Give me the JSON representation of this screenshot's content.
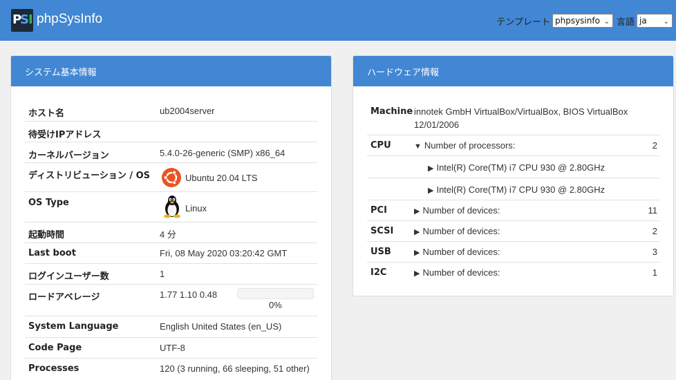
{
  "header": {
    "brand": "phpSysInfo",
    "template_label": "テンプレート",
    "template_value": "phpsysinfo",
    "language_label": "言語",
    "language_value": "ja"
  },
  "system": {
    "title": "システム基本情報",
    "rows": [
      {
        "label": "ホスト名",
        "value": "ub2004server"
      },
      {
        "label": "待受けIPアドレス",
        "value": ""
      },
      {
        "label": "カーネルバージョン",
        "value": "5.4.0-26-generic (SMP) x86_64"
      },
      {
        "label": "ディストリビューション / OS",
        "value": "Ubuntu 20.04 LTS",
        "icon": "ubuntu-logo-icon"
      },
      {
        "label": "OS Type",
        "value": "Linux",
        "icon": "linux-tux-icon"
      },
      {
        "label": "起動時間",
        "value": "4 分"
      },
      {
        "label": "Last boot",
        "value": "Fri, 08 May 2020 03:20:42 GMT"
      },
      {
        "label": "ログインユーザー数",
        "value": "1"
      },
      {
        "label": "ロードアベレージ",
        "value": "1.77 1.10 0.48",
        "progress": 0,
        "progress_text": "0%"
      },
      {
        "label": "System Language",
        "value": "English United States (en_US)"
      },
      {
        "label": "Code Page",
        "value": "UTF-8"
      },
      {
        "label": "Processes",
        "value": "120 (3 running, 66 sleeping, 51 other)"
      }
    ]
  },
  "hardware": {
    "title": "ハードウェア情報",
    "machine_label": "Machine",
    "machine_value_line1": "innotek GmbH VirtualBox/VirtualBox, BIOS VirtualBox",
    "machine_value_line2": "12/01/2006",
    "cpu": {
      "label": "CPU",
      "text": "Number of processors:",
      "count": "2",
      "expanded": true
    },
    "processors": [
      "Intel(R) Core(TM) i7 CPU 930 @ 2.80GHz",
      "Intel(R) Core(TM) i7 CPU 930 @ 2.80GHz"
    ],
    "devices": [
      {
        "label": "PCI",
        "text": "Number of devices:",
        "count": "11"
      },
      {
        "label": "SCSI",
        "text": "Number of devices:",
        "count": "2"
      },
      {
        "label": "USB",
        "text": "Number of devices:",
        "count": "3"
      },
      {
        "label": "I2C",
        "text": "Number of devices:",
        "count": "1"
      }
    ]
  },
  "colors": {
    "header_blue": "#4187d4",
    "ubuntu_orange": "#e95420"
  }
}
